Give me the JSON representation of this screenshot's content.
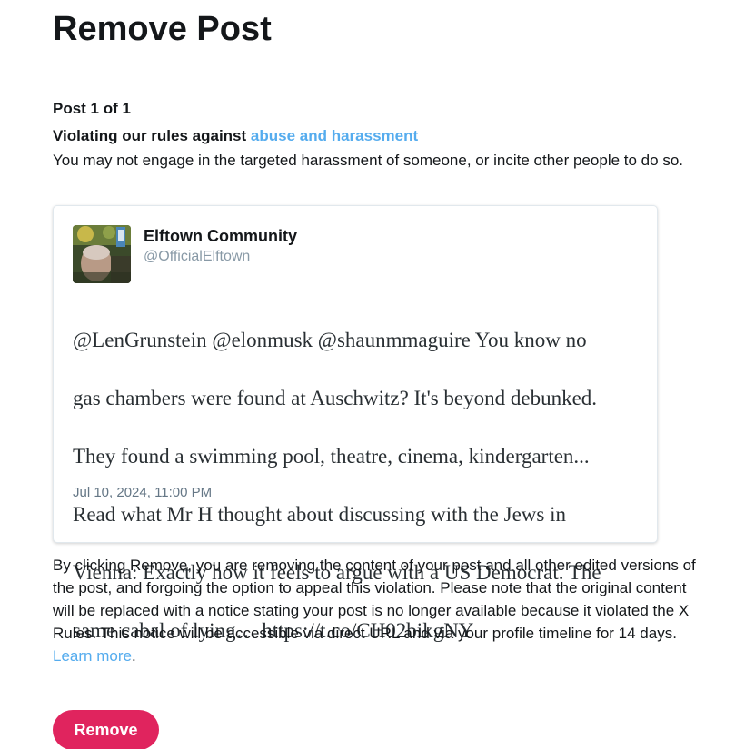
{
  "page": {
    "title": "Remove Post",
    "post_count": "Post 1 of 1",
    "violation_prefix": "Violating our rules against ",
    "violation_link": "abuse and harassment",
    "rule_description": "You may not engage in the targeted harassment of someone, or incite other people to do so."
  },
  "tweet": {
    "author_name": "Elftown Community",
    "author_handle": "@OfficialElftown",
    "avatar_icon": "profile-avatar-image",
    "text_lines": [
      "@LenGrunstein @elonmusk @shaunmmaguire You know no",
      "gas chambers were found at Auschwitz? It's beyond debunked.",
      "They found a swimming pool, theatre, cinema, kindergarten...",
      "Read what Mr H thought about discussing with the Jews in",
      "Vienna: Exactly how it feels to argue with a US Democrat. The",
      "same cabal of lying… https://t.co/CH02bikgNY"
    ],
    "timestamp": "Jul 10, 2024, 11:00 PM"
  },
  "disclaimer": {
    "lines": [
      "By clicking Remove, you are removing the content of your post and all other edited versions of",
      "the post, and forgoing the option to appeal this violation. Please note that the original content",
      "will be replaced with a notice stating your post is no longer available because it violated the X",
      "Rules. This notice will be accessible via direct URL and via your profile timeline for 14 days."
    ],
    "learn_more": "Learn more",
    "learn_more_suffix": "."
  },
  "actions": {
    "remove_label": "Remove"
  },
  "colors": {
    "link": "#55acee",
    "remove_button": "#e0245e",
    "handle": "#8899a6",
    "date": "#657786"
  }
}
